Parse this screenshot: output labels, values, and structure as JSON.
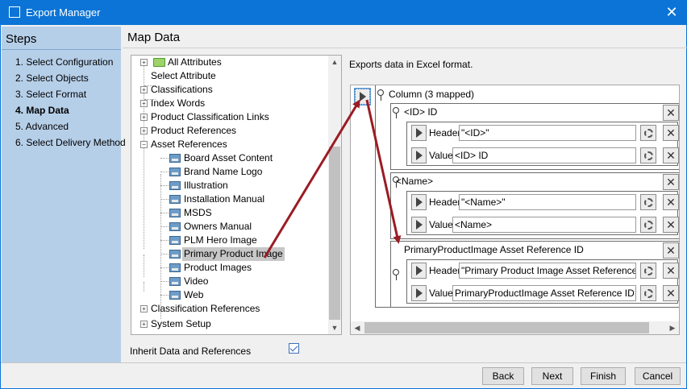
{
  "window": {
    "title": "Export Manager"
  },
  "steps": {
    "title": "Steps",
    "items": [
      "1. Select Configuration",
      "2. Select Objects",
      "3. Select Format",
      "4. Map Data",
      "5. Advanced",
      "6. Select Delivery Method"
    ]
  },
  "main": {
    "title": "Map Data",
    "exports_text": "Exports data in Excel format."
  },
  "tree": {
    "nodes": [
      "All Attributes",
      "Select Attribute",
      "Classifications",
      "Index Words",
      "Product Classification Links",
      "Product References",
      "Asset References",
      "Board Asset Content",
      "Brand Name Logo",
      "Illustration",
      "Installation Manual",
      "MSDS",
      "Owners Manual",
      "PLM Hero Image",
      "Primary Product Image",
      "Product Images",
      "Video",
      "Web",
      "Classification References",
      "System Setup"
    ]
  },
  "mapping": {
    "root_label": "Column (3 mapped)",
    "columns": [
      {
        "title": "<ID> ID",
        "header_label": "Header",
        "header_value": "\"<ID>\"",
        "value_label": "Value",
        "value_value": "<ID> ID"
      },
      {
        "title": "<Name>",
        "header_label": "Header",
        "header_value": "\"<Name>\"",
        "value_label": "Value",
        "value_value": "<Name>"
      },
      {
        "title": "PrimaryProductImage Asset Reference ID",
        "header_label": "Header",
        "header_value": "\"Primary Product Image Asset Reference ID\"",
        "value_label": "Value",
        "value_value": "PrimaryProductImage Asset Reference ID"
      }
    ]
  },
  "inherit": {
    "label": "Inherit Data and References",
    "checked": true
  },
  "buttons": {
    "back": "Back",
    "next": "Next",
    "finish": "Finish",
    "cancel": "Cancel"
  },
  "colors": {
    "titlebar": "#0b74d6",
    "steps_panel": "#b6cfe9",
    "arrow": "#9b1c24"
  }
}
